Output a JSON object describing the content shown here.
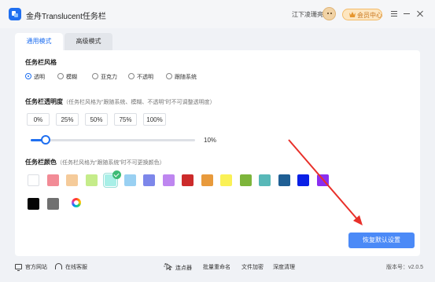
{
  "app": {
    "title": "金舟Translucent任务栏"
  },
  "header": {
    "username": "江下凌珊亮",
    "vip_label": "会员中心"
  },
  "tabs": [
    {
      "label": "通用模式",
      "active": true
    },
    {
      "label": "高级模式",
      "active": false
    }
  ],
  "style_section": {
    "title": "任务栏风格",
    "options": [
      "透明",
      "模糊",
      "亚克力",
      "不透明",
      "跟随系统"
    ],
    "selected": "透明"
  },
  "opacity_section": {
    "title": "任务栏透明度",
    "note": "（任务栏风格为“跟随系统、模糊、不透明”时不可调整透明度）",
    "presets": [
      "0%",
      "25%",
      "50%",
      "75%",
      "100%"
    ],
    "value_label": "10%",
    "value": 0.1
  },
  "color_section": {
    "title": "任务栏颜色",
    "note": "（任务栏风格为“跟随系统”时不可更换颜色）",
    "swatches": [
      "#ffffff",
      "#f28b96",
      "#f5cb9a",
      "#c5ec8a",
      "#a8efe7",
      "#99d0f2",
      "#7d87ea",
      "#be86f0",
      "#cc2b2b",
      "#e89a3c",
      "#faf156",
      "#7db53b",
      "#58b8b8",
      "#1f5f94",
      "#0a20e6",
      "#8a2ff0",
      "#050505",
      "#707070"
    ],
    "selected_index": 4,
    "custom_icon": "color-wheel-icon"
  },
  "reset_button": "恢复默认设置",
  "footer": {
    "official_site": "官方网站",
    "online_service": "在线客服",
    "clicker": "连点器",
    "batch_rename": "批量重命名",
    "file_encrypt": "文件加密",
    "deep_clean": "深度清理",
    "version_label": "版本号：",
    "version": "v2.0.5"
  },
  "colors": {
    "accent": "#1f6ff0",
    "button": "#4b8af7",
    "arrow": "#e8302a"
  }
}
